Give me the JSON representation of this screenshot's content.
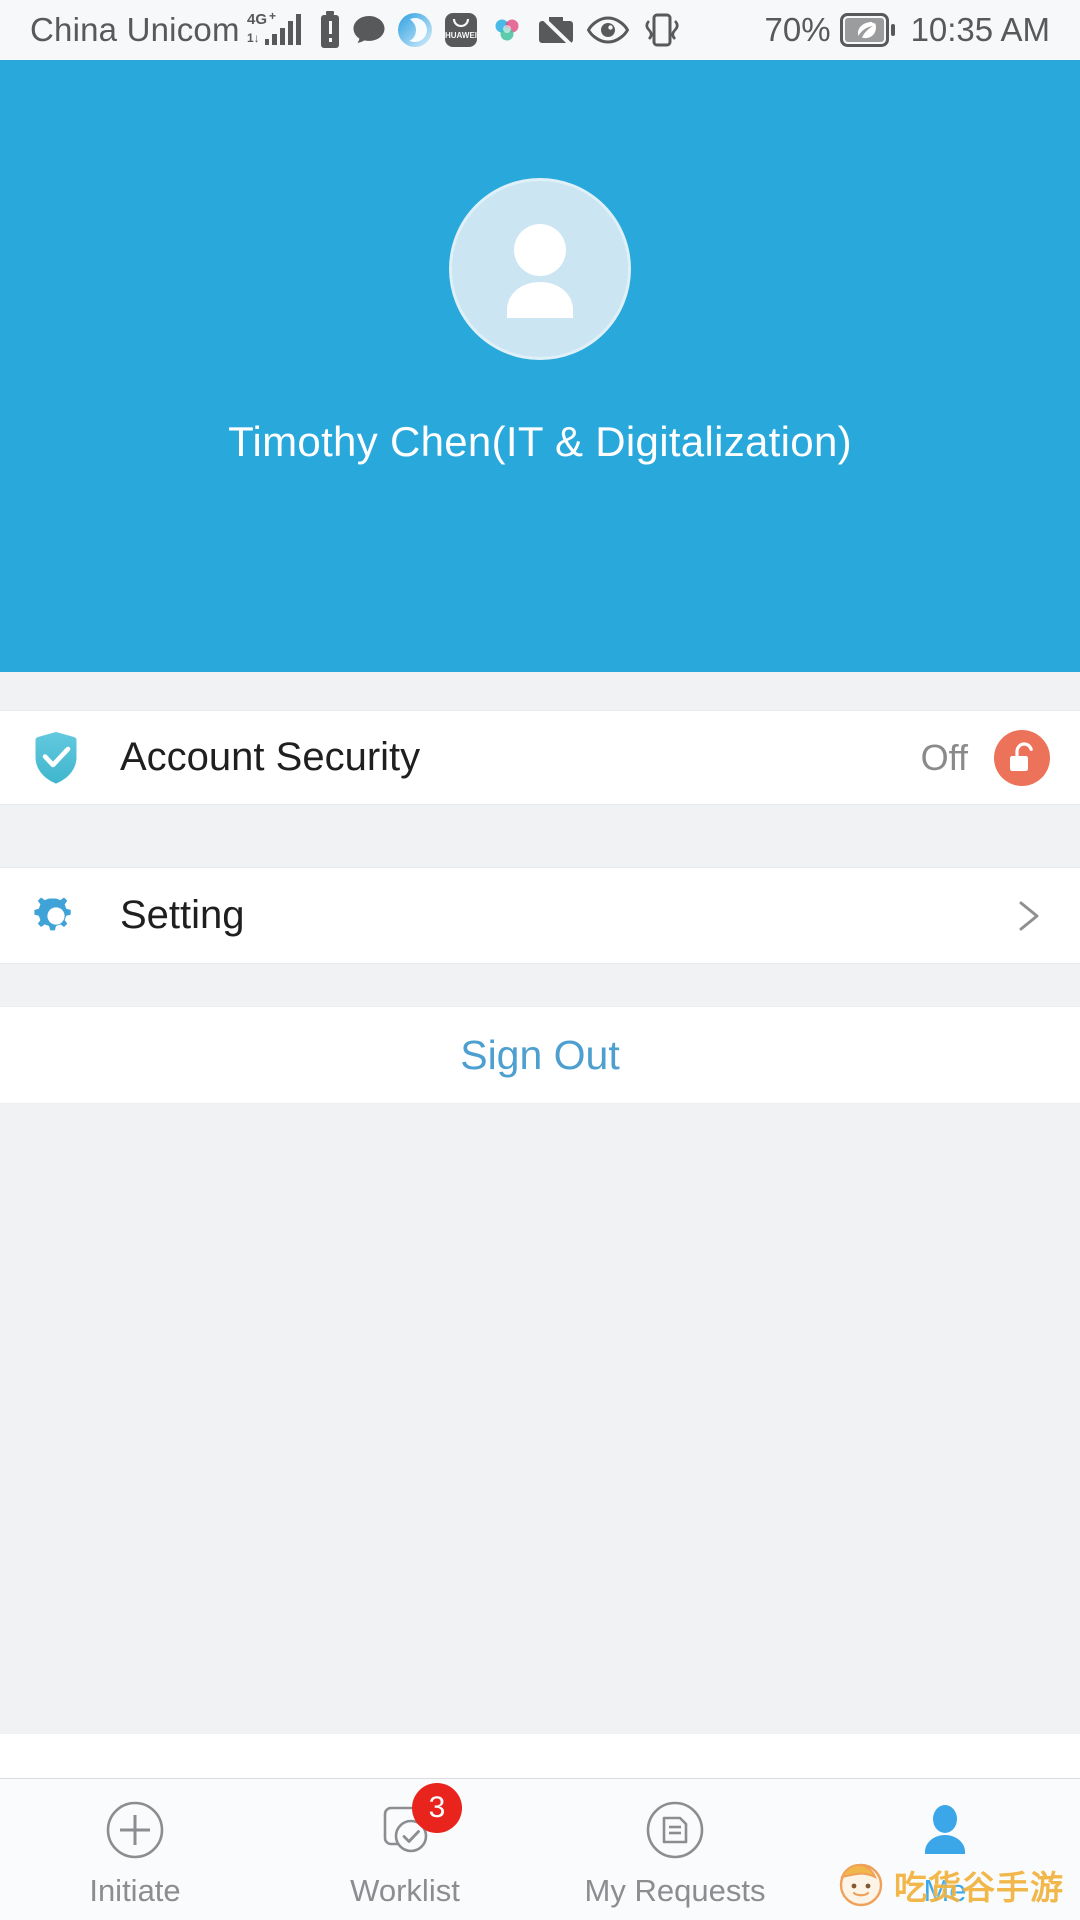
{
  "status_bar": {
    "carrier": "China Unicom",
    "network_type": "4G+",
    "battery_percent": "70%",
    "time": "10:35 AM",
    "icons": [
      "signal-bars-icon",
      "sim-alert-icon",
      "message-bubble-icon",
      "browser-icon",
      "huawei-appgallery-icon",
      "meetime-icon",
      "no-screenshot-icon",
      "eye-comfort-icon",
      "vibrate-icon",
      "battery-saver-icon"
    ]
  },
  "header": {
    "user_name": "Timothy Chen(IT & Digitalization)",
    "avatar_icon": "person-avatar-icon",
    "background_color": "#29a8dc"
  },
  "rows": {
    "account_security": {
      "icon": "shield-check-icon",
      "label": "Account Security",
      "value": "Off",
      "badge_icon": "unlock-padlock-icon",
      "badge_color": "#ec7259"
    },
    "setting": {
      "icon": "gear-icon",
      "label": "Setting",
      "accessory_icon": "chevron-right-icon"
    }
  },
  "sign_out": {
    "label": "Sign Out",
    "color": "#4d9fd0"
  },
  "tabbar": {
    "items": [
      {
        "label": "Initiate",
        "icon": "plus-circle-icon",
        "badge": "",
        "active": false
      },
      {
        "label": "Worklist",
        "icon": "task-check-icon",
        "badge": "3",
        "active": false
      },
      {
        "label": "My Requests",
        "icon": "document-circle-icon",
        "badge": "",
        "active": false
      },
      {
        "label": "Me",
        "icon": "person-filled-icon",
        "badge": "",
        "active": true
      }
    ],
    "active_color": "#3ba7e8",
    "inactive_color": "#8b8d90",
    "badge_color": "#e8241c"
  },
  "watermark": {
    "text": "吃货谷手游",
    "face_icon": "cartoon-face-icon",
    "color": "#f2b23c"
  }
}
